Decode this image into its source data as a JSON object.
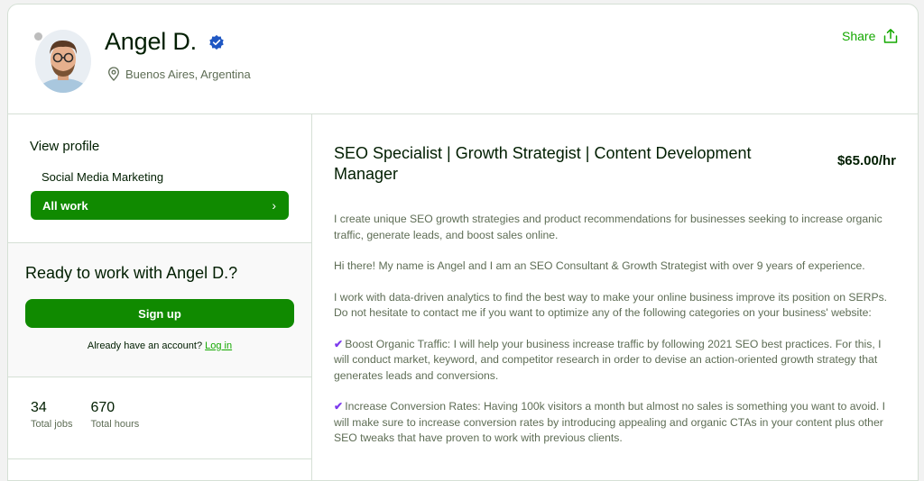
{
  "profile": {
    "name": "Angel D.",
    "location": "Buenos Aires, Argentina",
    "share_label": "Share"
  },
  "sidebar": {
    "view_profile": "View profile",
    "specialty": "Social Media Marketing",
    "all_work": "All work",
    "all_work_chevron": "›",
    "ready_title": "Ready to work with Angel D.?",
    "signup": "Sign up",
    "already": "Already have an account?",
    "login": "Log in",
    "stats": [
      {
        "value": "34",
        "label": "Total jobs"
      },
      {
        "value": "670",
        "label": "Total hours"
      }
    ]
  },
  "main": {
    "title": "SEO Specialist | Growth Strategist | Content Development Manager",
    "rate": "$65.00/hr",
    "paragraphs": [
      "I create unique SEO growth strategies and product recommendations for businesses seeking to increase organic traffic, generate leads, and boost sales online.",
      "Hi there! My name is Angel and I am an SEO Consultant & Growth Strategist with over 9 years of experience.",
      "I work with data-driven analytics to find the best way to make your online business improve its position on SERPs. Do not hesitate to contact me if you want to optimize any of the following categories on your business' website:",
      "Boost Organic Traffic: I will help your business increase traffic by following 2021 SEO best practices. For this, I will conduct market, keyword, and competitor research in order to devise an action-oriented growth strategy that generates leads and conversions.",
      "Increase Conversion Rates: Having 100k visitors a month but almost no sales is something you want to avoid. I will make sure to increase conversion rates by introducing appealing and organic CTAs in your content plus other SEO tweaks that have proven to work with previous clients."
    ],
    "check_mark": "✔"
  },
  "colors": {
    "brand_green": "#108a00",
    "link_green": "#14a800",
    "verified_blue": "#1f57c3",
    "check_purple": "#7c3aed"
  },
  "icons": {
    "verified": "verified-badge-icon",
    "location": "location-pin-icon",
    "share": "share-icon",
    "chevron": "chevron-right-icon",
    "check": "checkmark-icon"
  }
}
